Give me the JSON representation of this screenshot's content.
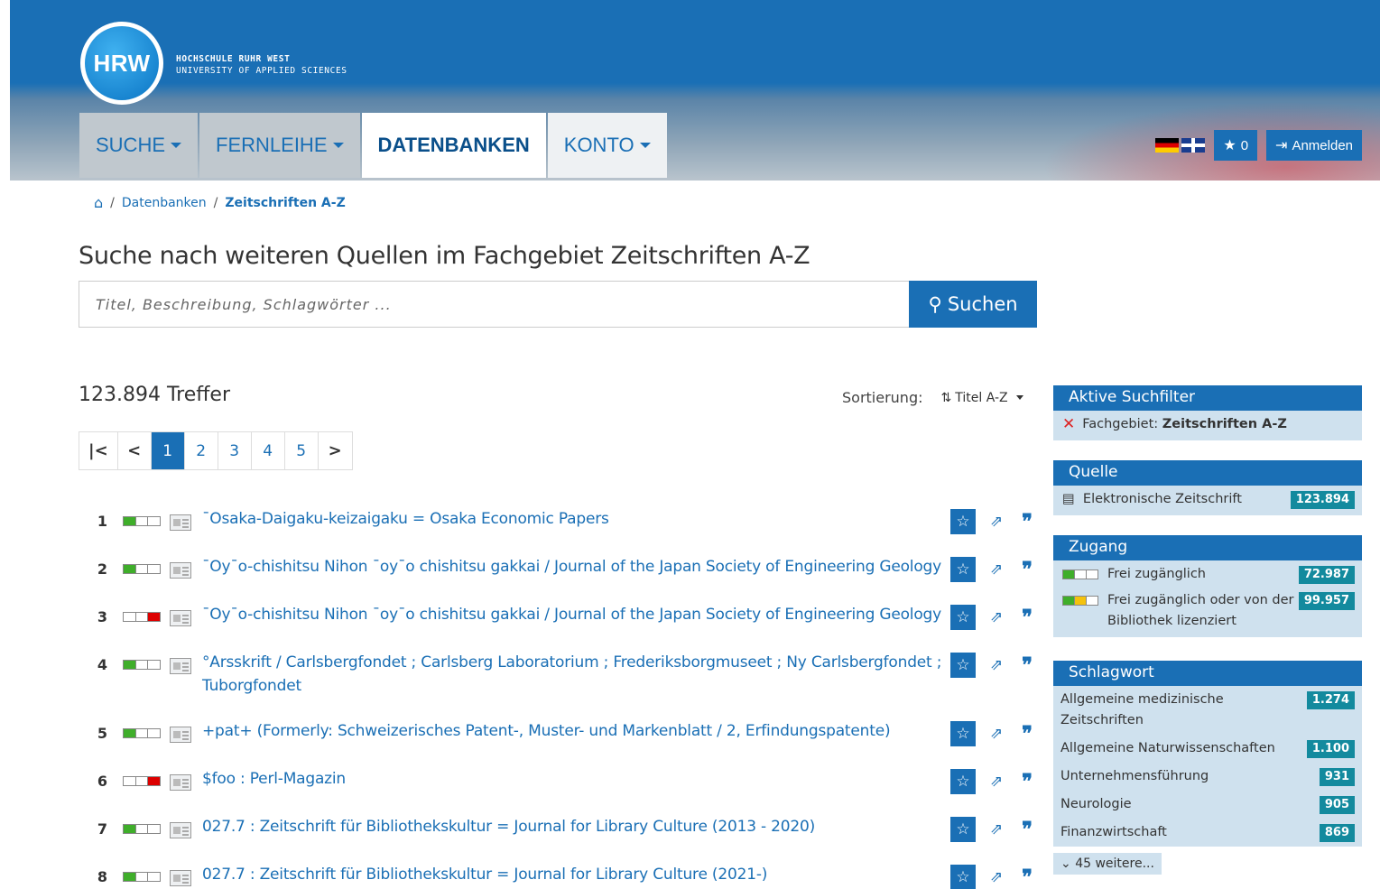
{
  "header": {
    "logo": "HRW",
    "university_line1": "HOCHSCHULE RUHR WEST",
    "university_line2": "UNIVERSITY OF APPLIED SCIENCES",
    "nav": [
      {
        "label": "SUCHE",
        "has_caret": true
      },
      {
        "label": "FERNLEIHE",
        "has_caret": true
      },
      {
        "label": "DATENBANKEN",
        "active": true
      },
      {
        "label": "KONTO",
        "has_caret": true
      }
    ],
    "favorites_count": "0",
    "login_label": "Anmelden"
  },
  "breadcrumb": {
    "home_icon": "home-icon",
    "items": [
      "Datenbanken",
      "Zeitschriften A-Z"
    ]
  },
  "search": {
    "heading": "Suche nach weiteren Quellen im Fachgebiet Zeitschriften A-Z",
    "placeholder": "Titel, Beschreibung, Schlagwörter ...",
    "button_label": "Suchen"
  },
  "results_meta": {
    "hits": "123.894 Treffer",
    "sort_label": "Sortierung:",
    "sort_value": "Titel A-Z"
  },
  "pagination": {
    "pages": [
      "1",
      "2",
      "3",
      "4",
      "5"
    ],
    "active": "1"
  },
  "results": [
    {
      "num": "1",
      "access": "green",
      "title": "¯Osaka-Daigaku-keizaigaku = Osaka Economic Papers"
    },
    {
      "num": "2",
      "access": "green",
      "title": "¯Oy¯o-chishitsu Nihon ¯oy¯o chishitsu gakkai / Journal of the Japan Society of Engineering Geology"
    },
    {
      "num": "3",
      "access": "red",
      "title": "¯Oy¯o-chishitsu Nihon ¯oy¯o chishitsu gakkai / Journal of the Japan Society of Engineering Geology"
    },
    {
      "num": "4",
      "access": "green",
      "title": "°Arsskrift / Carlsbergfondet ; Carlsberg Laboratorium ; Frederiksborgmuseet ; Ny Carlsbergfondet ; Tuborgfondet"
    },
    {
      "num": "5",
      "access": "green",
      "title": "+pat+ (Formerly: Schweizerisches Patent-, Muster- und Markenblatt / 2, Erfindungspatente)"
    },
    {
      "num": "6",
      "access": "red",
      "title": "$foo : Perl-Magazin"
    },
    {
      "num": "7",
      "access": "green",
      "title": "027.7 : Zeitschrift für Bibliothekskultur = Journal for Library Culture (2013 - 2020)"
    },
    {
      "num": "8",
      "access": "green",
      "title": "027.7 : Zeitschrift für Bibliothekskultur = Journal for Library Culture (2021-)"
    }
  ],
  "sidebar": {
    "active_filters": {
      "title": "Aktive Suchfilter",
      "filter_label": "Fachgebiet:",
      "filter_value": "Zeitschriften A-Z"
    },
    "quelle": {
      "title": "Quelle",
      "items": [
        {
          "label": "Elektronische Zeitschrift",
          "count": "123.894"
        }
      ]
    },
    "zugang": {
      "title": "Zugang",
      "items": [
        {
          "label": "Frei zugänglich",
          "count": "72.987"
        },
        {
          "label": "Frei zugänglich oder von der Bibliothek lizenziert",
          "count": "99.957"
        }
      ]
    },
    "schlagwort": {
      "title": "Schlagwort",
      "items": [
        {
          "label": "Allgemeine medizinische Zeitschriften",
          "count": "1.274"
        },
        {
          "label": "Allgemeine Naturwissenschaften",
          "count": "1.100"
        },
        {
          "label": "Unternehmensführung",
          "count": "931"
        },
        {
          "label": "Neurologie",
          "count": "905"
        },
        {
          "label": "Finanzwirtschaft",
          "count": "869"
        }
      ],
      "more_label": "45 weitere..."
    }
  },
  "colors": {
    "brand_blue": "#1a6fb5",
    "badge_teal": "#138a9e",
    "facet_bg": "#cfe1ee",
    "access_green": "#3fae2a",
    "access_yellow": "#f4c20d",
    "access_red": "#dd0000"
  }
}
